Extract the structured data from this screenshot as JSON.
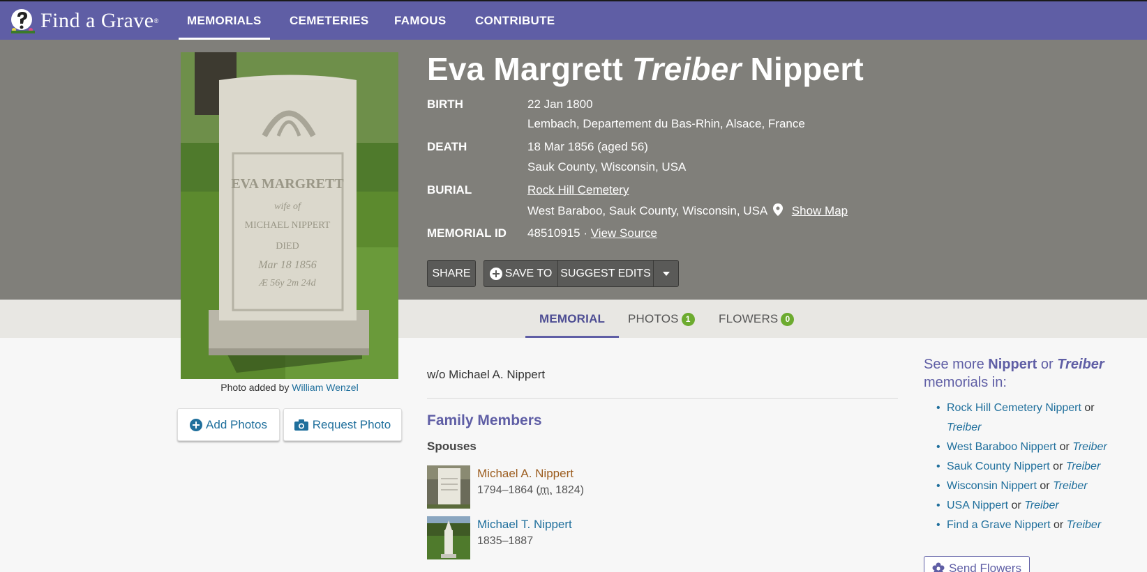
{
  "nav": {
    "logo_text": "Find a Grave",
    "logo_reg": "®",
    "items": [
      {
        "label": "MEMORIALS",
        "active": true
      },
      {
        "label": "CEMETERIES"
      },
      {
        "label": "FAMOUS"
      },
      {
        "label": "CONTRIBUTE"
      }
    ]
  },
  "memorial": {
    "name_first": "Eva Margrett",
    "name_middle": "Treiber",
    "name_last": "Nippert",
    "birth_label": "BIRTH",
    "birth_date": "22 Jan 1800",
    "birth_place": "Lembach, Departement du Bas-Rhin, Alsace, France",
    "death_label": "DEATH",
    "death_date": "18 Mar 1856 (aged 56)",
    "death_place": "Sauk County, Wisconsin, USA",
    "burial_label": "BURIAL",
    "burial_cemetery": "Rock Hill Cemetery",
    "burial_place": "West Baraboo, Sauk County, Wisconsin, USA",
    "show_map": "Show Map",
    "id_label": "MEMORIAL ID",
    "id_value": "48510915 ·",
    "view_source": "View Source"
  },
  "actions": {
    "share": "SHARE",
    "save_to": "SAVE TO",
    "suggest_edits": "SUGGEST EDITS"
  },
  "tabs": [
    {
      "label": "MEMORIAL",
      "active": true
    },
    {
      "label": "PHOTOS",
      "badge": "1"
    },
    {
      "label": "FLOWERS",
      "badge": "0"
    }
  ],
  "photo": {
    "caption_prefix": "Photo added by",
    "caption_author": "William Wenzel",
    "inscription_1": "EVA MARGRETT",
    "inscription_2": "wife of",
    "inscription_3": "MICHAEL NIPPERT",
    "inscription_4": "DIED",
    "inscription_5": "Mar 18 1856",
    "inscription_6": "Æ 56y 2m 24d"
  },
  "photo_buttons": {
    "add": "Add Photos",
    "request": "Request Photo"
  },
  "bio": "w/o Michael A. Nippert",
  "family": {
    "title": "Family Members",
    "spouses_title": "Spouses",
    "members": [
      {
        "name": "Michael A. Nippert",
        "dates": "1794–1864 (",
        "m_abbr": "m.",
        "m_year": " 1824)",
        "color": "#9c5d1f"
      },
      {
        "name": "Michael T. Nippert",
        "dates": "1835–1887",
        "color": "#1f6f9c"
      }
    ]
  },
  "sidebar": {
    "title_prefix": "See more",
    "title_name": "Nippert",
    "title_or": "or",
    "title_maiden": "Treiber",
    "title_suffix": "memorials in:",
    "items": [
      {
        "place": "Rock Hill Cemetery",
        "name": "Nippert",
        "or": "or",
        "maiden": "Treiber"
      },
      {
        "place": "West Baraboo",
        "name": "Nippert",
        "or": "or",
        "maiden": "Treiber"
      },
      {
        "place": "Sauk County",
        "name": "Nippert",
        "or": "or",
        "maiden": "Treiber"
      },
      {
        "place": "Wisconsin",
        "name": "Nippert",
        "or": "or",
        "maiden": "Treiber"
      },
      {
        "place": "USA",
        "name": "Nippert",
        "or": "or",
        "maiden": "Treiber"
      },
      {
        "place": "Find a Grave",
        "name": "Nippert",
        "or": "or",
        "maiden": "Treiber"
      }
    ],
    "send_flowers": "Send Flowers"
  },
  "colors": {
    "nav": "#5f5ea5",
    "hero": "#807f7a",
    "link": "#1f6f9c",
    "badge": "#6cab2f"
  }
}
